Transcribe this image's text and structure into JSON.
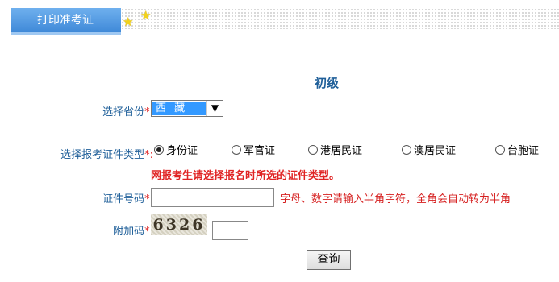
{
  "header": {
    "tab_label": "打印准考证"
  },
  "form": {
    "section_title": "初级",
    "province_label": "选择省份",
    "province_value": "西 藏",
    "id_type_label": "选择报考证件类型",
    "required_mark": "*:",
    "id_types": [
      {
        "label": "身份证",
        "checked": true
      },
      {
        "label": "军官证",
        "checked": false
      },
      {
        "label": "港居民证",
        "checked": false
      },
      {
        "label": "澳居民证",
        "checked": false
      },
      {
        "label": "台胞证",
        "checked": false
      }
    ],
    "id_type_warning": "网报考生请选择报名时所选的证件类型。",
    "id_number_label": "证件号码",
    "id_number_value": "",
    "id_number_hint": "字母、数字请输入半角字符，全角会自动转为半角",
    "captcha_label": "附加码",
    "captcha_text": "6326",
    "captcha_value": "",
    "submit_label": "查询"
  }
}
